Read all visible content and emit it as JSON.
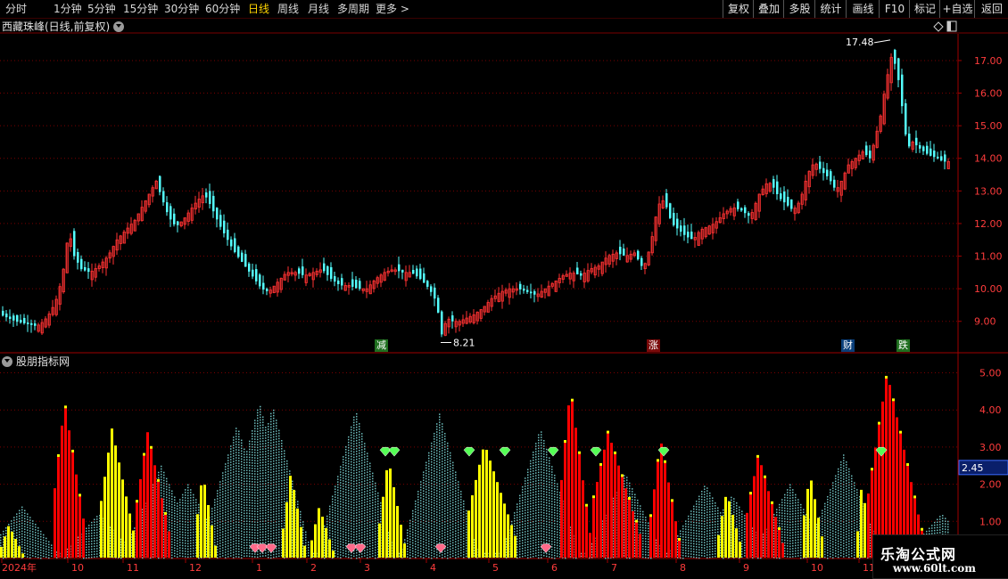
{
  "toolbar": {
    "periods": [
      "分时",
      "1分钟",
      "5分钟",
      "15分钟",
      "30分钟",
      "60分钟",
      "日线",
      "周线",
      "月线",
      "多周期",
      "更多 >"
    ],
    "active_period": "日线",
    "right_buttons": [
      "复权",
      "叠加",
      "多股",
      "统计",
      "画线",
      "F10",
      "标记",
      "+自选",
      "返回"
    ]
  },
  "pane1": {
    "title": "西藏珠峰(日线,前复权)",
    "y_axis_labels": [
      "17.00",
      "16.00",
      "15.00",
      "14.00",
      "13.00",
      "12.00",
      "11.00",
      "10.00",
      "9.00"
    ],
    "high_label": "17.48",
    "low_label": "8.21",
    "events": [
      "减",
      "涨",
      "财",
      "跌"
    ]
  },
  "pane2": {
    "title": "股朋指标网",
    "y_axis_labels": [
      "5.00",
      "4.00",
      "3.00",
      "2.00",
      "1.00"
    ],
    "current_value": "2.45"
  },
  "x_axis": {
    "labels": [
      "2024年",
      "10",
      "11",
      "12",
      "1",
      "2",
      "3",
      "4",
      "5",
      "6",
      "7",
      "8",
      "9",
      "10",
      "11"
    ]
  },
  "watermark": {
    "line1": "乐淘公式网",
    "line2": "www.60lt.com"
  },
  "colors": {
    "up": "#ff3232",
    "down": "#54ffff",
    "grid": "#7a0000",
    "axis_text": "#ff3c3c",
    "bar_yellow": "#ffff00",
    "bar_red": "#ff0000",
    "bar_cyan": "#6fbfbf",
    "diamond_green": "#55ff55",
    "diamond_pink": "#ff6a8a"
  },
  "chart_data": [
    {
      "type": "candlestick",
      "title": "西藏珠峰(日线,前复权)",
      "x_months": [
        "2024年",
        "10",
        "11",
        "12",
        "1",
        "2",
        "3",
        "4",
        "5",
        "6",
        "7",
        "8",
        "9",
        "10",
        "11"
      ],
      "ylim": [
        8.2,
        17.6
      ],
      "close_path": [
        [
          0,
          9.2
        ],
        [
          8,
          9.1
        ],
        [
          16,
          9.0
        ],
        [
          24,
          8.95
        ],
        [
          32,
          8.9
        ],
        [
          40,
          8.85
        ],
        [
          48,
          9.0
        ],
        [
          56,
          9.3
        ],
        [
          64,
          9.8
        ],
        [
          70,
          10.6
        ],
        [
          76,
          11.8
        ],
        [
          82,
          11.0
        ],
        [
          90,
          10.6
        ],
        [
          100,
          10.5
        ],
        [
          110,
          10.7
        ],
        [
          120,
          11.0
        ],
        [
          130,
          11.5
        ],
        [
          140,
          11.8
        ],
        [
          150,
          12.1
        ],
        [
          160,
          12.6
        ],
        [
          168,
          13.0
        ],
        [
          174,
          13.3
        ],
        [
          180,
          12.8
        ],
        [
          188,
          12.2
        ],
        [
          196,
          11.9
        ],
        [
          204,
          12.1
        ],
        [
          212,
          12.4
        ],
        [
          220,
          12.7
        ],
        [
          228,
          12.9
        ],
        [
          236,
          12.5
        ],
        [
          244,
          12.0
        ],
        [
          252,
          11.6
        ],
        [
          260,
          11.2
        ],
        [
          268,
          10.9
        ],
        [
          276,
          10.6
        ],
        [
          284,
          10.3
        ],
        [
          292,
          10.0
        ],
        [
          300,
          9.9
        ],
        [
          310,
          10.2
        ],
        [
          320,
          10.5
        ],
        [
          330,
          10.5
        ],
        [
          340,
          10.4
        ],
        [
          350,
          10.5
        ],
        [
          360,
          10.6
        ],
        [
          370,
          10.3
        ],
        [
          380,
          10.1
        ],
        [
          390,
          10.1
        ],
        [
          400,
          10.0
        ],
        [
          410,
          10.0
        ],
        [
          420,
          10.3
        ],
        [
          430,
          10.5
        ],
        [
          440,
          10.6
        ],
        [
          450,
          10.5
        ],
        [
          460,
          10.5
        ],
        [
          470,
          10.3
        ],
        [
          480,
          10.0
        ],
        [
          488,
          9.6
        ],
        [
          494,
          8.6
        ],
        [
          500,
          9.1
        ],
        [
          506,
          9.0
        ],
        [
          514,
          9.0
        ],
        [
          522,
          9.1
        ],
        [
          530,
          9.2
        ],
        [
          540,
          9.4
        ],
        [
          550,
          9.7
        ],
        [
          560,
          9.9
        ],
        [
          570,
          10.0
        ],
        [
          580,
          10.0
        ],
        [
          590,
          9.9
        ],
        [
          600,
          9.8
        ],
        [
          610,
          10.0
        ],
        [
          620,
          10.2
        ],
        [
          630,
          10.4
        ],
        [
          640,
          10.5
        ],
        [
          650,
          10.4
        ],
        [
          660,
          10.6
        ],
        [
          670,
          10.7
        ],
        [
          680,
          11.0
        ],
        [
          690,
          11.1
        ],
        [
          700,
          11.0
        ],
        [
          710,
          11.1
        ],
        [
          720,
          10.6
        ],
        [
          728,
          11.3
        ],
        [
          734,
          12.2
        ],
        [
          740,
          12.8
        ],
        [
          746,
          12.5
        ],
        [
          752,
          12.0
        ],
        [
          760,
          11.8
        ],
        [
          768,
          11.6
        ],
        [
          776,
          11.5
        ],
        [
          784,
          11.8
        ],
        [
          792,
          11.9
        ],
        [
          800,
          12.0
        ],
        [
          810,
          12.3
        ],
        [
          820,
          12.5
        ],
        [
          830,
          12.4
        ],
        [
          840,
          12.2
        ],
        [
          850,
          12.9
        ],
        [
          860,
          13.3
        ],
        [
          866,
          13.1
        ],
        [
          872,
          12.8
        ],
        [
          880,
          12.6
        ],
        [
          888,
          12.4
        ],
        [
          896,
          12.7
        ],
        [
          904,
          13.5
        ],
        [
          912,
          13.9
        ],
        [
          920,
          13.6
        ],
        [
          928,
          13.4
        ],
        [
          936,
          13.0
        ],
        [
          942,
          13.3
        ],
        [
          950,
          13.8
        ],
        [
          958,
          14.0
        ],
        [
          966,
          14.2
        ],
        [
          974,
          14.0
        ],
        [
          980,
          14.6
        ],
        [
          986,
          15.3
        ],
        [
          992,
          16.3
        ],
        [
          998,
          17.1
        ],
        [
          1004,
          16.8
        ],
        [
          1010,
          15.6
        ],
        [
          1016,
          14.3
        ],
        [
          1022,
          14.5
        ],
        [
          1030,
          14.3
        ],
        [
          1040,
          14.1
        ],
        [
          1050,
          14.0
        ],
        [
          1056,
          13.9
        ],
        [
          1064,
          13.9
        ]
      ]
    },
    {
      "type": "bar",
      "title": "股朋指标网",
      "ylim": [
        0,
        5.3
      ],
      "last_value": 2.45,
      "yellow_clusters": [
        [
          0,
          24,
          0.9
        ],
        [
          110,
          150,
          3.5
        ],
        [
          218,
          240,
          2.3
        ],
        [
          316,
          340,
          2.3
        ],
        [
          348,
          372,
          1.4
        ],
        [
          424,
          452,
          2.7
        ],
        [
          522,
          578,
          3.1
        ],
        [
          804,
          830,
          1.8
        ],
        [
          898,
          922,
          2.3
        ],
        [
          960,
          974,
          2.1
        ]
      ],
      "red_clusters": [
        [
          58,
          95,
          4.2
        ],
        [
          150,
          190,
          3.4
        ],
        [
          626,
          660,
          4.6
        ],
        [
          660,
          718,
          3.4
        ],
        [
          728,
          760,
          3.2
        ],
        [
          834,
          876,
          2.8
        ],
        [
          972,
          1032,
          5.0
        ]
      ],
      "cyan_peaks": [
        [
          24,
          1.4
        ],
        [
          110,
          1.2
        ],
        [
          180,
          2.5
        ],
        [
          210,
          2.0
        ],
        [
          265,
          3.6
        ],
        [
          290,
          4.2
        ],
        [
          305,
          4.1
        ],
        [
          398,
          4.0
        ],
        [
          492,
          3.9
        ],
        [
          605,
          3.5
        ],
        [
          700,
          2.3
        ],
        [
          790,
          2.0
        ],
        [
          820,
          1.7
        ],
        [
          885,
          2.0
        ],
        [
          945,
          2.8
        ],
        [
          1055,
          1.2
        ]
      ],
      "green_diamonds_x": [
        432,
        442,
        526,
        566,
        620,
        668,
        744,
        988
      ],
      "pink_diamonds_x": [
        286,
        294,
        304,
        394,
        404,
        494,
        612
      ]
    }
  ]
}
